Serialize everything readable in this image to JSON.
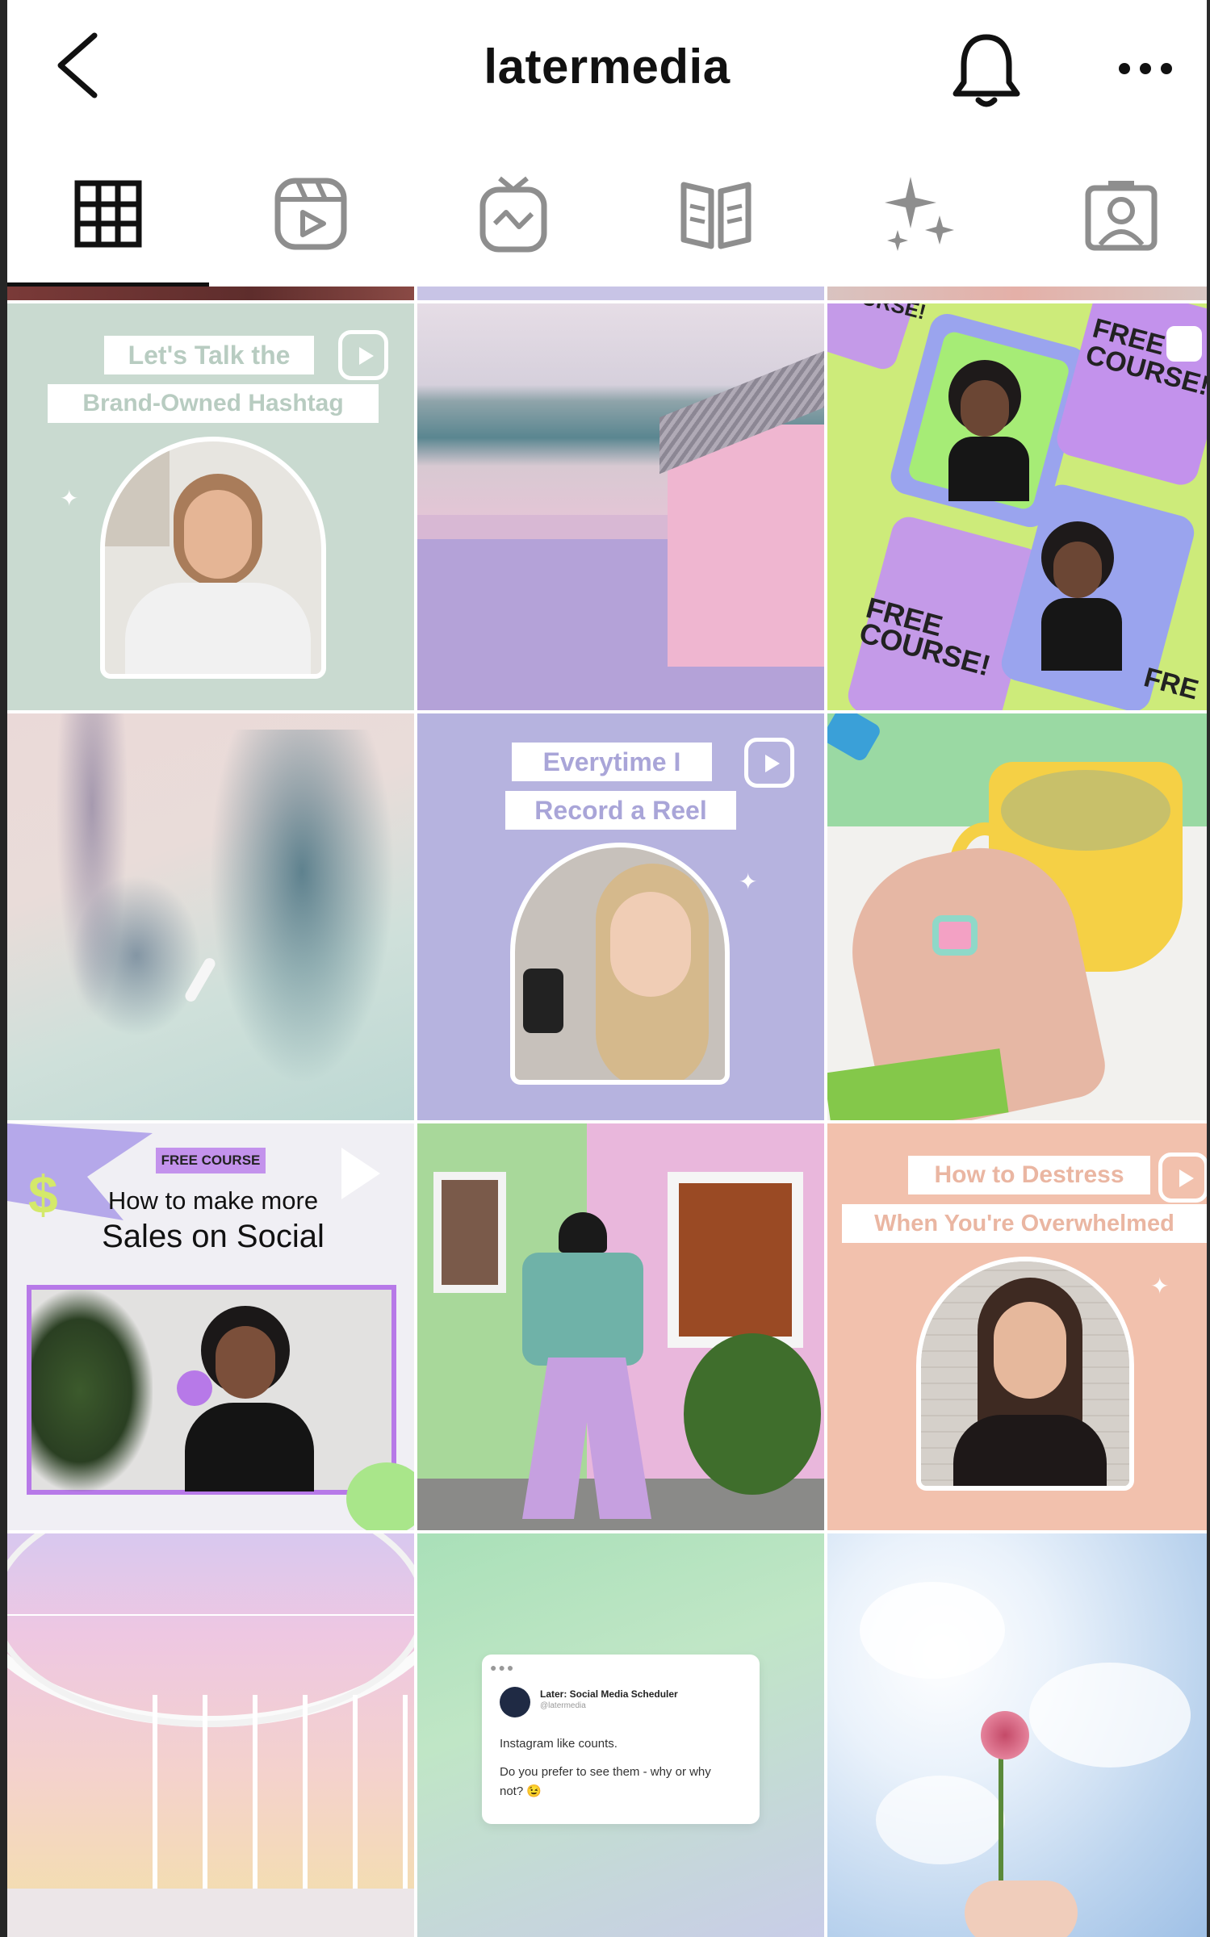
{
  "header": {
    "title": "latermedia"
  },
  "tabs": [
    {
      "icon": "grid-icon",
      "active": true
    },
    {
      "icon": "reels-icon",
      "active": false
    },
    {
      "icon": "igtv-icon",
      "active": false
    },
    {
      "icon": "guides-icon",
      "active": false
    },
    {
      "icon": "sparkles-icon",
      "active": false
    },
    {
      "icon": "tagged-icon",
      "active": false
    }
  ],
  "posts": {
    "p1": {
      "line1": "Let's Talk the",
      "line2": "Brand-Owned Hashtag"
    },
    "p3": {
      "tag1": "COURSE!",
      "tag2": "FREE COURSE!",
      "tag3": "FREE COURSE!",
      "tag4": "FRE"
    },
    "p5": {
      "line1": "Everytime I",
      "line2": "Record a Reel"
    },
    "p7": {
      "badge": "FREE COURSE",
      "line1": "How to make more",
      "line2": "Sales on Social"
    },
    "p9": {
      "line1": "How to Destress",
      "line2": "When You're Overwhelmed"
    },
    "p11": {
      "account": "Later: Social Media Scheduler",
      "handle": "@latermedia",
      "line1": "Instagram like counts.",
      "line2": "Do you prefer to see them - why or why not? 😉"
    }
  },
  "colors": {
    "sage": "#c9dad0",
    "lavender": "#b6b3df",
    "peach": "#f2c1ad",
    "purple_accent": "#b779e8",
    "text_dark": "#111111"
  }
}
